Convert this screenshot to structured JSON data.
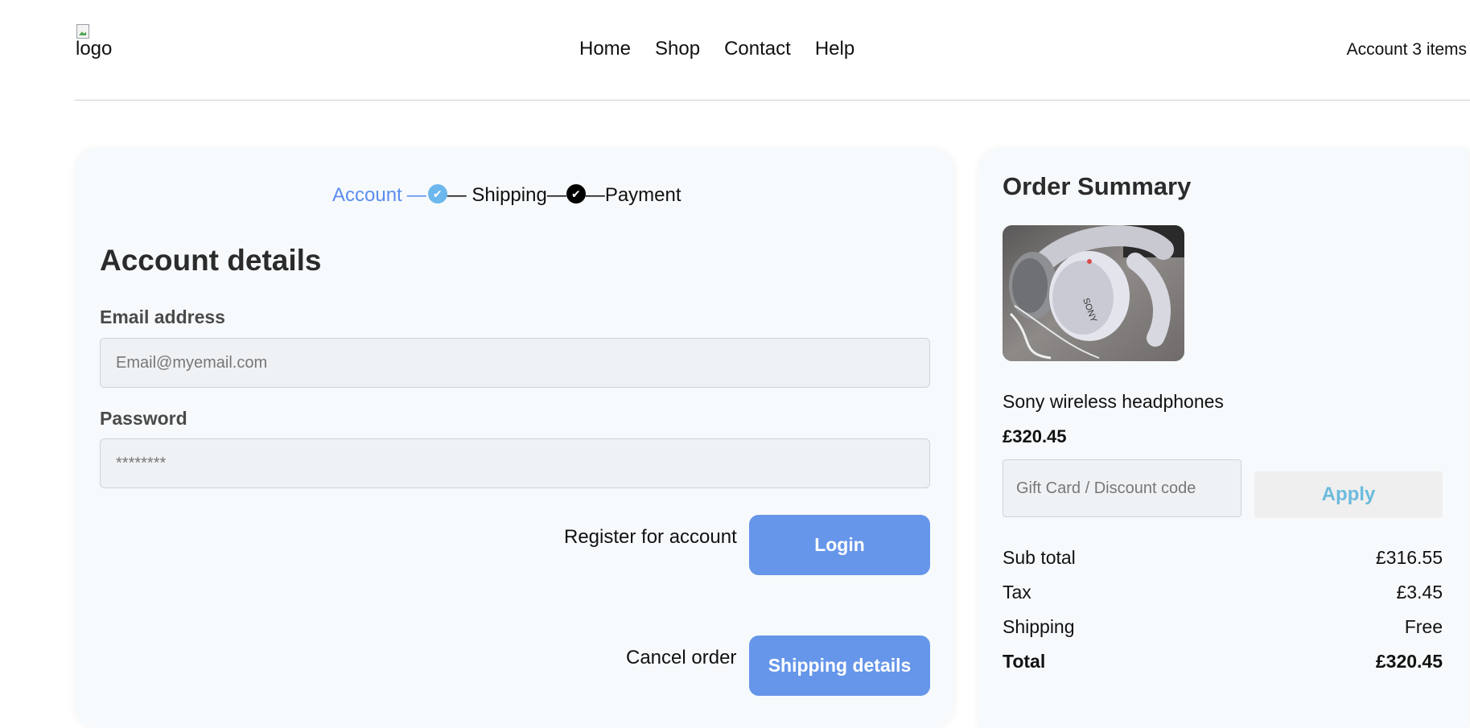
{
  "header": {
    "logo_alt": "logo",
    "nav": [
      "Home",
      "Shop",
      "Contact",
      "Help"
    ],
    "account_link": "Account 3 items"
  },
  "checkout": {
    "steps": [
      "Account",
      "Shipping",
      "Payment"
    ],
    "current_step": "Account",
    "title": "Account details",
    "email_label": "Email address",
    "email_placeholder": "Email@myemail.com",
    "password_label": "Password",
    "password_placeholder": "********",
    "register_link": "Register for account",
    "login_button": "Login",
    "cancel_link": "Cancel order",
    "next_button": "Shipping details"
  },
  "summary": {
    "title": "Order Summary",
    "product": {
      "name": "Sony wireless headphones",
      "price": "£320.45",
      "image": "sony-headphones-photo"
    },
    "discount_placeholder": "Gift Card / Discount code",
    "apply_button": "Apply",
    "totals": [
      {
        "label": "Sub total",
        "value": "£316.55"
      },
      {
        "label": "Tax",
        "value": "£3.45"
      },
      {
        "label": "Shipping",
        "value": "Free"
      },
      {
        "label": "Total",
        "value": "£320.45"
      }
    ]
  },
  "colors": {
    "accent": "#6696e9",
    "step_active": "#5b8def",
    "check_done": "#6cb7ee",
    "apply_text": "#6cbbdd",
    "card_bg": "#f7fafc"
  }
}
